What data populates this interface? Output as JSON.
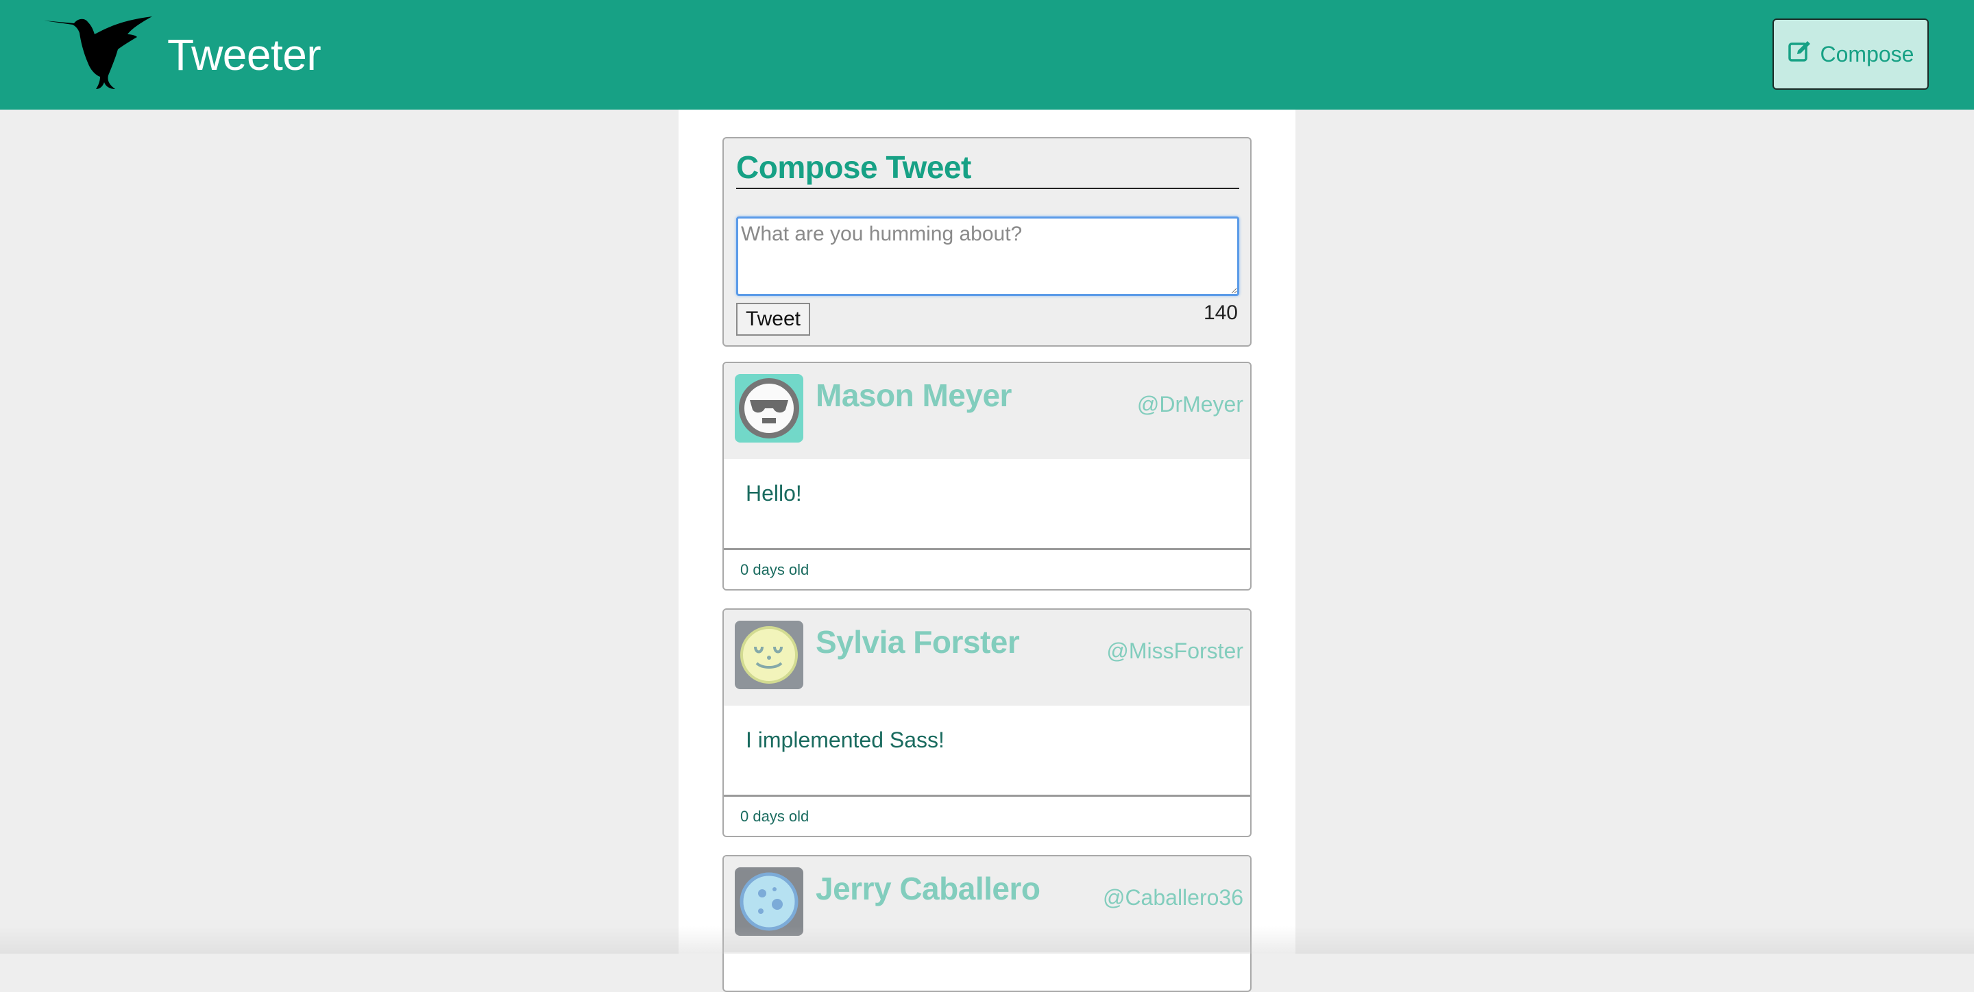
{
  "nav": {
    "brand": "Tweeter",
    "compose_label": "Compose",
    "logo_icon": "hummingbird-icon",
    "compose_icon": "edit-icon"
  },
  "compose": {
    "title": "Compose Tweet",
    "placeholder": "What are you humming about?",
    "value": "",
    "tweet_button": "Tweet",
    "counter": "140"
  },
  "tweets": [
    {
      "name": "Mason Meyer",
      "handle": "@DrMeyer",
      "text": "Hello!",
      "age": "0 days old",
      "avatar_icon": "sunglasses-face-icon"
    },
    {
      "name": "Sylvia Forster",
      "handle": "@MissForster",
      "text": "I implemented Sass!",
      "age": "0 days old",
      "avatar_icon": "germ-icon"
    },
    {
      "name": "Jerry Caballero",
      "handle": "@Caballero36",
      "text": "",
      "age": "",
      "avatar_icon": "cell-icon"
    }
  ],
  "colors": {
    "brand": "#17a185",
    "compose_button_bg": "#c6ebe3",
    "name_color": "#82cdbd",
    "page_bg": "#eeeeee"
  }
}
